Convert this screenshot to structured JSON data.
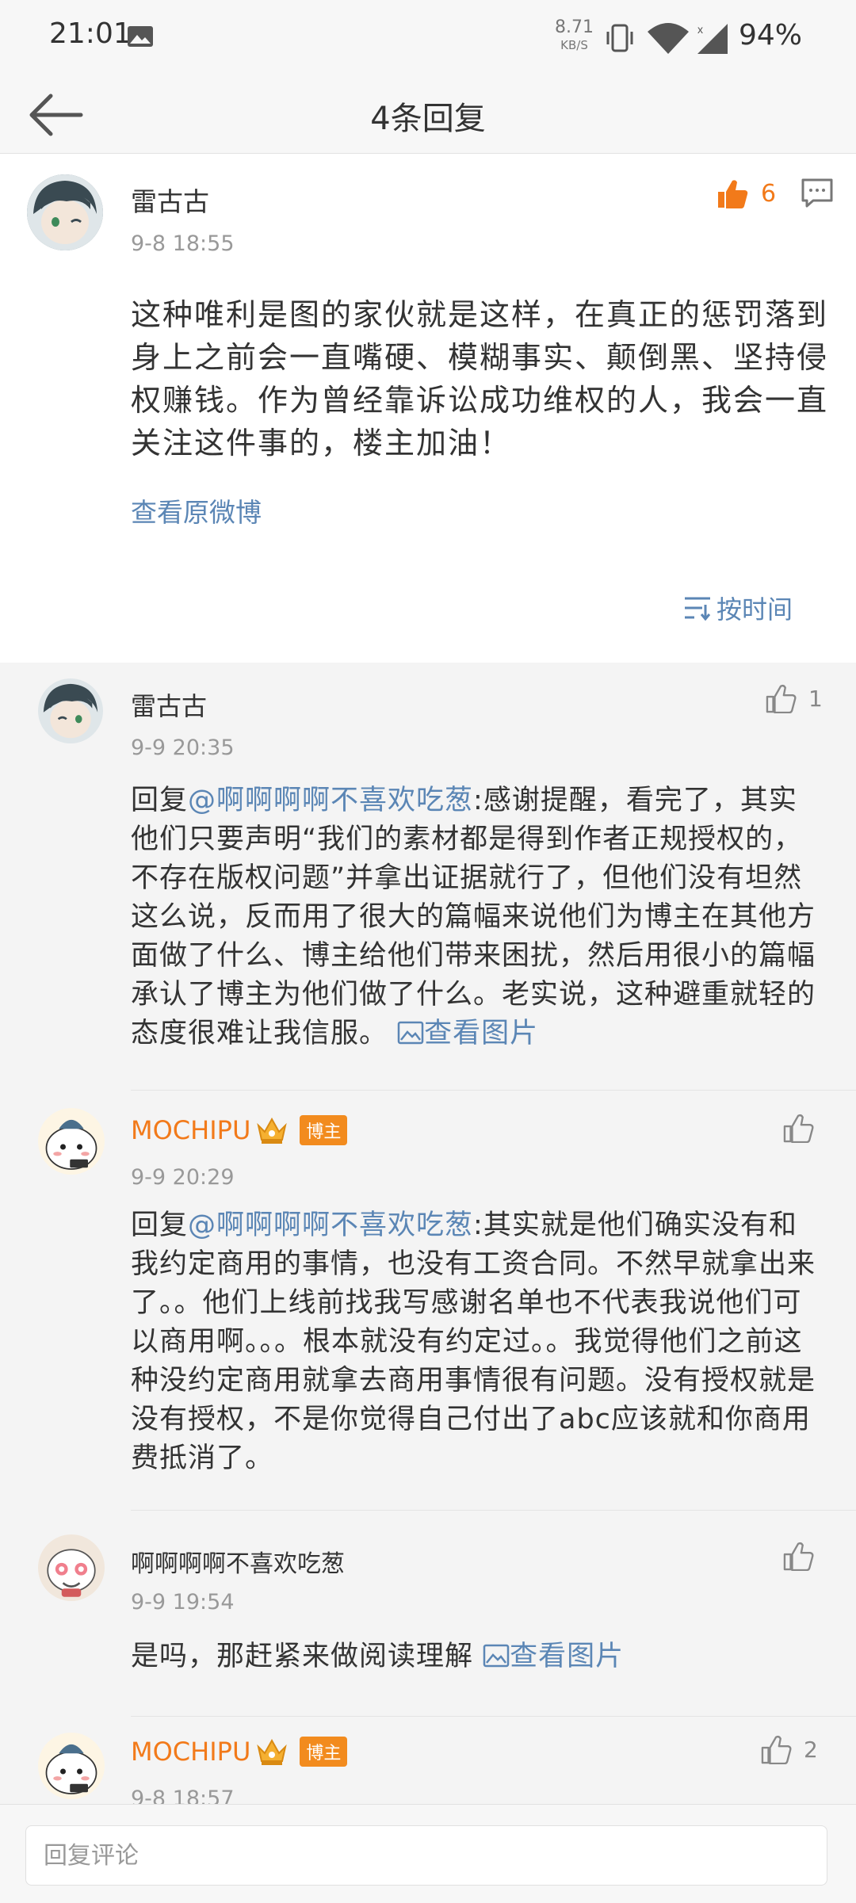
{
  "status_bar": {
    "time": "21:01",
    "net_speed_value": "8.71",
    "net_speed_unit": "KB/S",
    "battery": "94%"
  },
  "header": {
    "title": "4条回复"
  },
  "main_comment": {
    "user": "雷古古",
    "time": "9-8 18:55",
    "likes": "6",
    "text": "这种唯利是图的家伙就是这样，在真正的惩罚落到身上之前会一直嘴硬、模糊事实、颠倒黑、坚持侵权赚钱。作为曾经靠诉讼成功维权的人，我会一直关注这件事的，楼主加油！",
    "view_original": "查看原微博",
    "sort_label": "按时间"
  },
  "replies": [
    {
      "user": "雷古古",
      "time": "9-9 20:35",
      "likes": "1",
      "prefix": "回复",
      "mention": "@啊啊啊啊不喜欢吃葱",
      "text": ":感谢提醒，看完了，其实他们只要声明“我们的素材都是得到作者正规授权的，不存在版权问题”并拿出证据就行了，但他们没有坦然这么说，反而用了很大的篇幅来说他们为博主在其他方面做了什么、博主给他们带来困扰，然后用很小的篇幅承认了博主为他们做了什么。老实说，这种避重就轻的态度很难让我信服。",
      "image_link": "查看图片"
    },
    {
      "user": "MOCHIPU",
      "badge": "博主",
      "time": "9-9 20:29",
      "likes": "",
      "prefix": "回复",
      "mention": "@啊啊啊啊不喜欢吃葱",
      "text": ":其实就是他们确实没有和我约定商用的事情，也没有工资合同。不然早就拿出来了。。他们上线前找我写感谢名单也不代表我说他们可以商用啊。。。根本就没有约定过。。我觉得他们之前这种没约定商用就拿去商用事情很有问题。没有授权就是没有授权，不是你觉得自己付出了abc应该就和你商用费抵消了。"
    },
    {
      "user": "啊啊啊啊不喜欢吃葱",
      "time": "9-9 19:54",
      "likes": "",
      "text": "是吗，那赶紧来做阅读理解",
      "image_link": "查看图片"
    },
    {
      "user": "MOCHIPU",
      "badge": "博主",
      "time": "9-8 18:57",
      "likes": "2"
    }
  ],
  "input": {
    "placeholder": "回复评论"
  },
  "colors": {
    "accent_orange": "#f27a1a",
    "link_blue": "#5b86b5",
    "badge_orange": "#f28b1e"
  }
}
